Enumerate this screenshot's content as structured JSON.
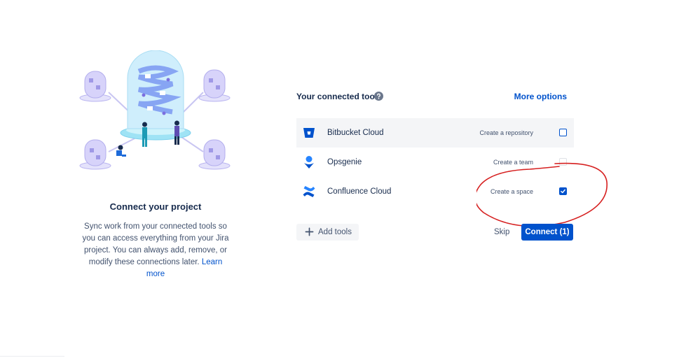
{
  "left_panel": {
    "title": "Connect your project",
    "description": "Sync work from your connected tools so you can access everything from your Jira project. You can always add, remove, or modify these connections later.",
    "learn_more": "Learn more"
  },
  "tools": {
    "title": "Your connected tools",
    "help_icon": "question-circle-icon",
    "more_options": "More options",
    "items": [
      {
        "name": "Bitbucket Cloud",
        "icon": "bitbucket-icon",
        "action": "Create a repository",
        "checked": false
      },
      {
        "name": "Opsgenie",
        "icon": "opsgenie-icon",
        "action": "Create a team",
        "checked": false
      },
      {
        "name": "Confluence Cloud",
        "icon": "confluence-icon",
        "action": "Create a space",
        "checked": true
      }
    ]
  },
  "actions": {
    "add_tools": "Add tools",
    "skip": "Skip",
    "connect": "Connect (1)"
  },
  "colors": {
    "primary": "#0052cc",
    "text": "#172b4d",
    "subtle_text": "#42526e",
    "row_highlight": "#f4f5f7",
    "annotation": "#d62020"
  }
}
